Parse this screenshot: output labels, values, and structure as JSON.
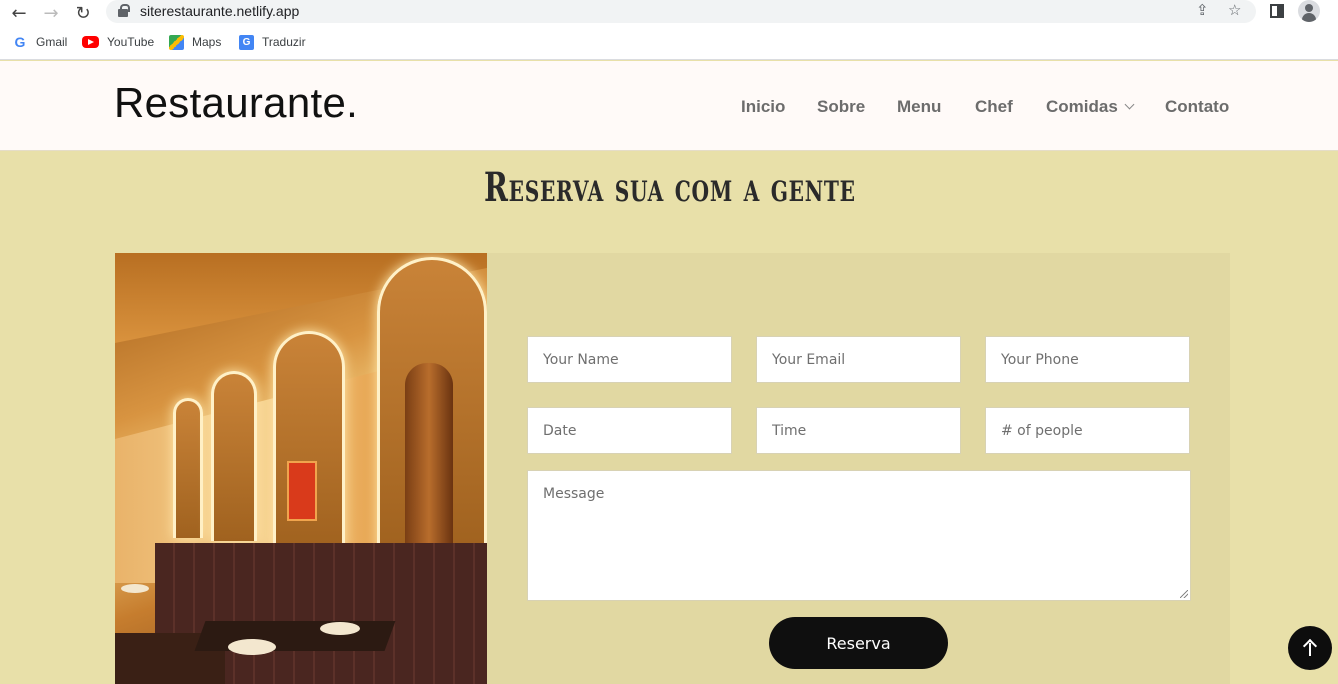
{
  "browser": {
    "url": "siterestaurante.netlify.app",
    "bookmarks": [
      {
        "label": "Gmail",
        "icon": "google-icon"
      },
      {
        "label": "YouTube",
        "icon": "youtube-icon"
      },
      {
        "label": "Maps",
        "icon": "maps-icon"
      },
      {
        "label": "Traduzir",
        "icon": "translate-icon"
      }
    ]
  },
  "site": {
    "logo": "Restaurante.",
    "nav": [
      "Inicio",
      "Sobre",
      "Menu",
      "Chef",
      "Comidas",
      "Contato"
    ]
  },
  "reservation": {
    "title": "Reserva sua com a gente",
    "fields": {
      "name": "Your Name",
      "email": "Your Email",
      "phone": "Your Phone",
      "date": "Date",
      "time": "Time",
      "people": "# of people",
      "message": "Message"
    },
    "submit_label": "Reserva"
  },
  "colors": {
    "page_bg": "#e8e0a9",
    "panel_bg": "#e1d8a2",
    "header_bg": "#fffaf8",
    "button_bg": "#0f0f0f"
  }
}
